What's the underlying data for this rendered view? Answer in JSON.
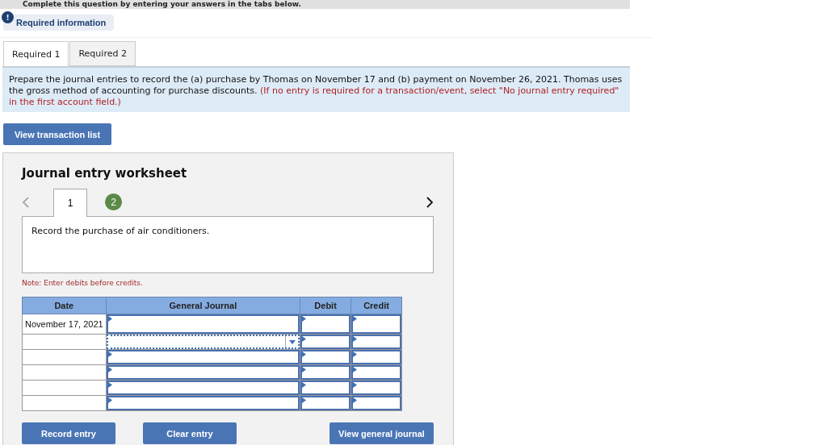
{
  "header": {
    "title": "Complete this question by entering your answers in the tabs below."
  },
  "required_info": {
    "badge": "!",
    "label": "Required information"
  },
  "tabs": [
    {
      "label": "Required 1",
      "selected": true
    },
    {
      "label": "Required 2",
      "selected": false
    }
  ],
  "instructions": {
    "text": "Prepare the journal entries to record the (a) purchase by Thomas on November 17 and (b) payment on November 26, 2021. Thomas uses the gross method of accounting for purchase discounts.",
    "note": "(If no entry is required for a transaction/event, select \"No journal entry required\" in the first account field.)"
  },
  "view_transaction_button": "View transaction list",
  "worksheet": {
    "title": "Journal entry worksheet",
    "steps": [
      {
        "label": "1",
        "selected": true
      },
      {
        "label": "2",
        "selected": false
      }
    ],
    "description": "Record the purchase of air conditioners.",
    "note": "Note: Enter debits before credits.",
    "table": {
      "columns": [
        "Date",
        "General Journal",
        "Debit",
        "Credit"
      ],
      "rows": [
        {
          "date": "November 17, 2021",
          "focused": false
        },
        {
          "focused": true
        },
        {
          "focused": false
        },
        {
          "focused": false
        },
        {
          "focused": false
        },
        {
          "focused": false
        }
      ]
    },
    "buttons": [
      "Record entry",
      "Clear entry",
      "View general journal"
    ]
  }
}
